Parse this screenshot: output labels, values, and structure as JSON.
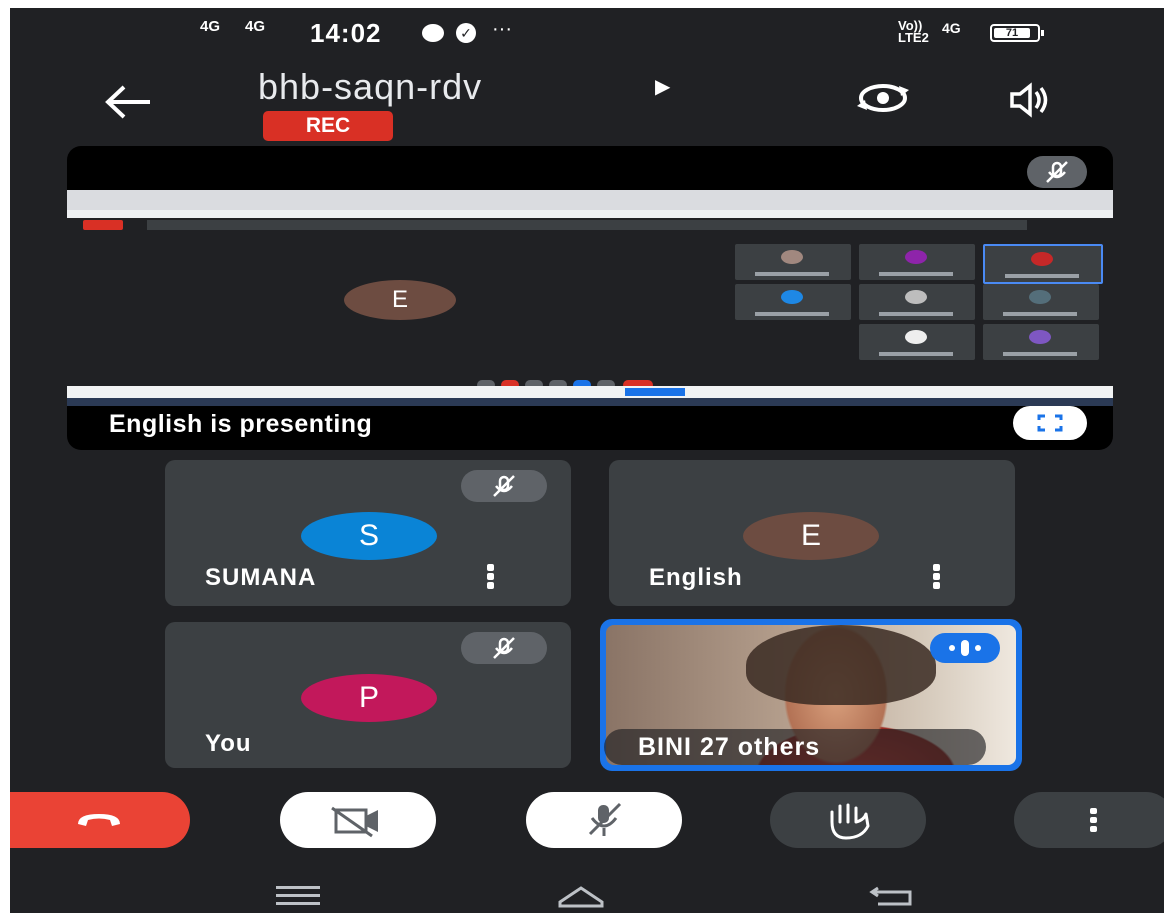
{
  "status_bar": {
    "time": "14:02",
    "net1": "4G",
    "net2": "4G",
    "volte": "Vo))",
    "lte": "LTE2",
    "net3": "4G",
    "battery": "71",
    "more": "···"
  },
  "header": {
    "meeting_code": "bhb-saqn-rdv",
    "rec_label": "REC",
    "back_icon": "arrow-left-icon",
    "switch_camera_icon": "switch-camera-icon",
    "speaker_icon": "speaker-icon"
  },
  "presentation": {
    "caption": "English is presenting",
    "presenter_initial": "E"
  },
  "tiles": [
    {
      "name": "SUMANA",
      "initial": "S",
      "color": "#0a84d6",
      "muted": true
    },
    {
      "name": "English",
      "initial": "E",
      "color": "#6d4c41",
      "muted": false
    },
    {
      "name": "You",
      "initial": "P",
      "color": "#c2185b",
      "muted": true
    },
    {
      "name": "BINI   27 others",
      "video": true,
      "speaking": true
    }
  ],
  "controls": {
    "end_call": "end-call-icon",
    "camera": "camera-off-icon",
    "mic": "mic-off-icon",
    "hand": "raise-hand-icon",
    "more": "more-vertical-icon"
  },
  "colors": {
    "background": "#202124",
    "tile": "#3c4043",
    "rec": "#d93025",
    "end_call": "#ea4335",
    "accent": "#1a73e8"
  }
}
